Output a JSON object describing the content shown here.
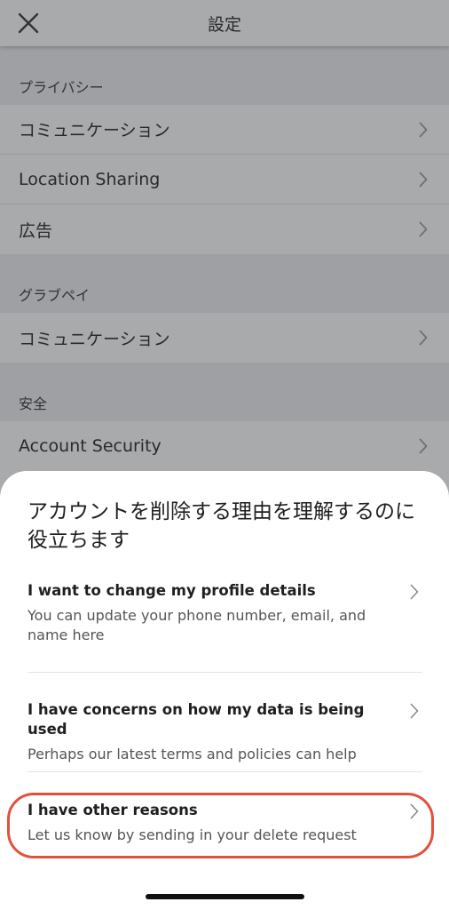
{
  "header": {
    "title": "設定"
  },
  "sections": [
    {
      "label": "プライバシー",
      "items": [
        "コミュニケーション",
        "Location Sharing",
        "広告"
      ]
    },
    {
      "label": "グラブペイ",
      "items": [
        "コミュニケーション"
      ]
    },
    {
      "label": "安全",
      "items": [
        "Account Security"
      ]
    }
  ],
  "sheet": {
    "title": "アカウントを削除する理由を理解するのに役立ちます",
    "options": [
      {
        "title": "I want to change my profile details",
        "description": "You can update your phone number, email, and name here"
      },
      {
        "title": "I have concerns on how my data is being used",
        "description": "Perhaps our latest terms and policies can help"
      },
      {
        "title": "I have other reasons",
        "description": "Let us know by sending in your delete request"
      }
    ]
  },
  "colors": {
    "highlight": "#e2513c",
    "overlay": "#a9aaac"
  }
}
